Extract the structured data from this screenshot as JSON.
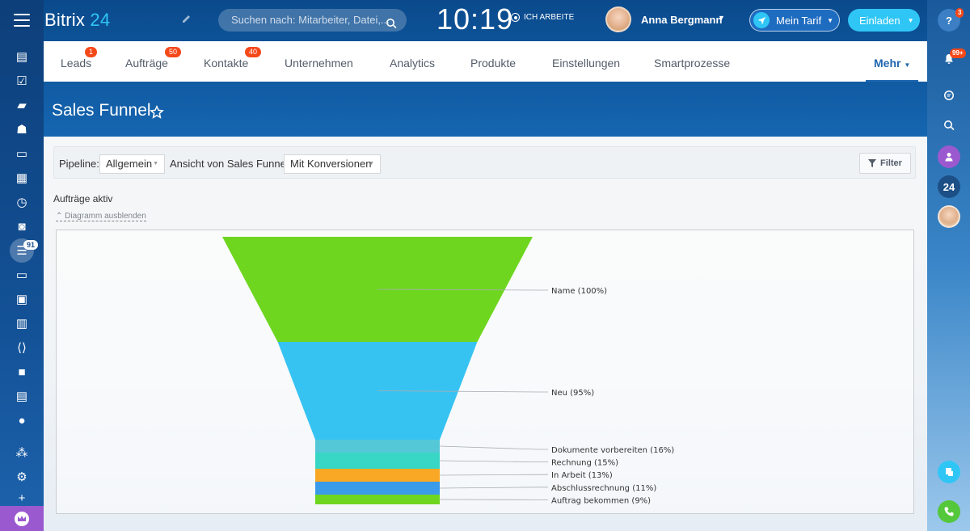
{
  "app": {
    "logo_text": "Bitrix",
    "logo_num": "24"
  },
  "header": {
    "search_placeholder": "Suchen nach: Mitarbeiter, Datei,...",
    "clock": "10:19",
    "work_status": "ICH ARBEITE",
    "user_name": "Anna Bergmann",
    "tarif_label": "Mein Tarif",
    "invite_label": "Einladen"
  },
  "left_sidebar": {
    "badge": "91",
    "icons": [
      "menu-icon",
      "feed-icon",
      "tasks-icon",
      "chat-icon",
      "group-icon",
      "drive-icon",
      "calendar-icon",
      "time-icon",
      "robot-icon",
      "crm-icon",
      "sites-icon",
      "contacts-icon",
      "knowledge-icon",
      "dev-icon",
      "video-icon",
      "docs-icon",
      "more-icon",
      "structure-icon",
      "settings-icon",
      "add-icon"
    ]
  },
  "right_sidebar": {
    "help_badge": "3",
    "notif_badge": "99+",
    "logo_24": "24"
  },
  "nav": {
    "tabs": [
      {
        "label": "Leads",
        "badge": "1"
      },
      {
        "label": "Aufträge",
        "badge": "50"
      },
      {
        "label": "Kontakte",
        "badge": "40"
      },
      {
        "label": "Unternehmen",
        "badge": ""
      },
      {
        "label": "Analytics",
        "badge": ""
      },
      {
        "label": "Produkte",
        "badge": ""
      },
      {
        "label": "Einstellungen",
        "badge": ""
      },
      {
        "label": "Smartprozesse",
        "badge": ""
      },
      {
        "label": "Mehr",
        "badge": ""
      }
    ]
  },
  "page": {
    "title": "Sales Funnel",
    "pipeline_label": "Pipeline:",
    "pipeline_value": "Allgemein",
    "view_label": "Ansicht von Sales Funnel:",
    "view_value": "Mit Konversionen",
    "filter_label": "Filter",
    "section_title": "Aufträge aktiv",
    "hide_link": "Diagramm ausblenden"
  },
  "chart_data": {
    "type": "funnel",
    "stages": [
      {
        "label": "Name (100%)",
        "value": 100,
        "color": "#6ed61f"
      },
      {
        "label": "Neu (95%)",
        "value": 95,
        "color": "#37c3f2"
      },
      {
        "label": "Dokumente vorbereiten (16%)",
        "value": 16,
        "color": "#55c8d8"
      },
      {
        "label": "Rechnung (15%)",
        "value": 15,
        "color": "#38d6c4"
      },
      {
        "label": "In Arbeit (13%)",
        "value": 13,
        "color": "#f9a825"
      },
      {
        "label": "Abschlussrechnung (11%)",
        "value": 11,
        "color": "#3a9be8"
      },
      {
        "label": "Auftrag bekommen (9%)",
        "value": 9,
        "color": "#6ed61f"
      }
    ]
  }
}
